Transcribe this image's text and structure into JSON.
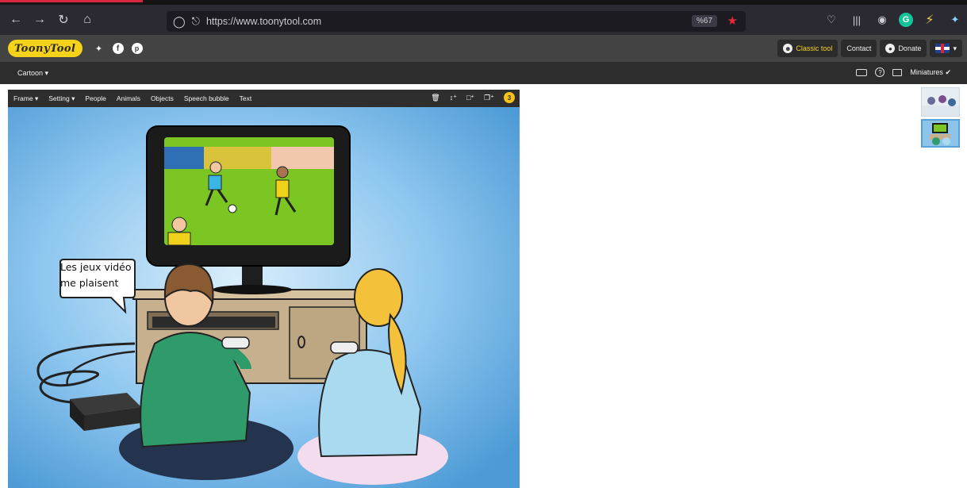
{
  "browser": {
    "url": "https://www.toonytool.com",
    "zoom": "%67"
  },
  "site": {
    "logo_text": "ToonyTool",
    "header_buttons": {
      "classic": "Classic tool",
      "contact": "Contact",
      "donate": "Donate"
    }
  },
  "sub_toolbar": {
    "cartoon_menu": "Cartoon",
    "miniatures": "Miniatures"
  },
  "editor": {
    "toolbar": {
      "frame": "Frame",
      "setting": "Setting",
      "people": "People",
      "animals": "Animals",
      "objects": "Objects",
      "speech_bubble": "Speech bubble",
      "text": "Text"
    },
    "count": "3",
    "speech_line1": "Les jeux vidéo",
    "speech_line2": "me plaisent"
  },
  "colors": {
    "accent_yellow": "#f6d21a",
    "sky_blue": "#6fb4e6",
    "chrome_dark": "#2b2a33",
    "star_red": "#e52a38"
  },
  "icons": [
    "back-icon",
    "forward-icon",
    "reload-icon",
    "home-icon",
    "shield-icon",
    "lock-icon",
    "star-icon",
    "pocket-icon",
    "library-icon",
    "twitter-icon",
    "facebook-icon",
    "pinterest-icon",
    "trash-icon",
    "keyboard-icon",
    "help-icon",
    "screen-icon",
    "check-icon"
  ]
}
